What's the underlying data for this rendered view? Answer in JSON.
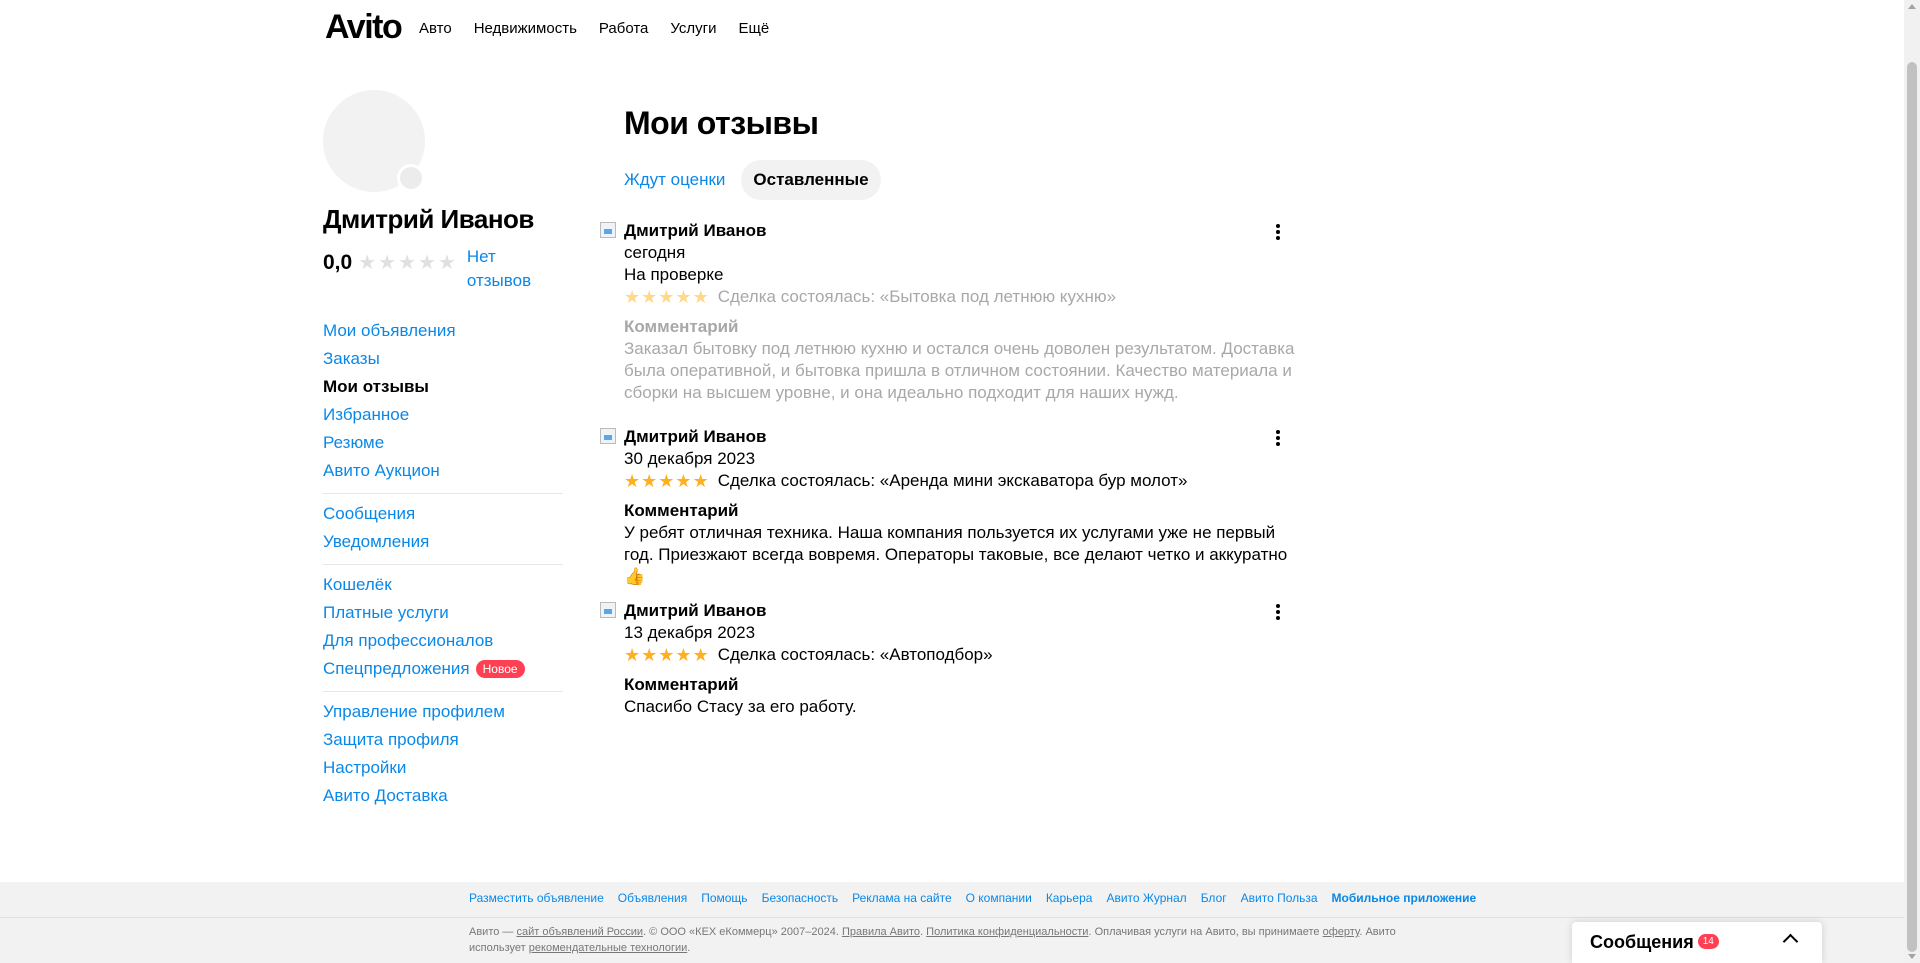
{
  "header": {
    "logo": "Avito",
    "nav": [
      "Авто",
      "Недвижимость",
      "Работа",
      "Услуги",
      "Ещё"
    ]
  },
  "profile": {
    "name": "Дмитрий Иванов",
    "rating": "0,0",
    "no_reviews": "Нет отзывов"
  },
  "menu": {
    "groups": [
      [
        "Мои объявления",
        "Заказы",
        "Мои отзывы",
        "Избранное",
        "Резюме",
        "Авито Аукцион"
      ],
      [
        "Сообщения",
        "Уведомления"
      ],
      [
        "Кошелёк",
        "Платные услуги",
        "Для профессионалов",
        "Спецпредложения"
      ],
      [
        "Управление профилем",
        "Защита профиля",
        "Настройки",
        "Авито Доставка"
      ]
    ],
    "new_badge": "Новое",
    "active": "Мои отзывы"
  },
  "main": {
    "title": "Мои отзывы",
    "tabs": [
      "Ждут оценки",
      "Оставленные"
    ],
    "comment_label": "Комментарий",
    "reviews": [
      {
        "author": "Дмитрий Иванов",
        "date": "сегодня",
        "status": "На проверке",
        "rating": 5,
        "deal": "Сделка состоялась: «Бытовка под летнюю кухню»",
        "comment": "Заказал бытовку под летнюю кухню и остался очень доволен результатом. Доставка была оперативной, и бытовка пришла в отличном состоянии. Качество материала и сборки на высшем уровне, и она идеально подходит для наших нужд."
      },
      {
        "author": "Дмитрий Иванов",
        "date": "30 декабря 2023",
        "rating": 5,
        "deal": "Сделка состоялась: «Аренда мини экскаватора бур молот»",
        "comment": "У ребят отличная техника. Наша компания пользуется их услугами уже не первый год. Приезжают всегда вовремя. Операторы таковые, все делают четко и аккуратно 👍"
      },
      {
        "author": "Дмитрий Иванов",
        "date": "13 декабря 2023",
        "rating": 5,
        "deal": "Сделка состоялась: «Автоподбор»",
        "comment": "Спасибо Стасу за его работу."
      }
    ]
  },
  "footer": {
    "links": [
      "Разместить объявление",
      "Объявления",
      "Помощь",
      "Безопасность",
      "Реклама на сайте",
      "О компании",
      "Карьера",
      "Авито Журнал",
      "Блог",
      "Авито Польза",
      "Мобильное приложение"
    ],
    "legal": {
      "p1": "Авито — ",
      "l1": "сайт объявлений России",
      "p2": ". © ООО «КЕХ еКоммерц» 2007–2024. ",
      "l2": "Правила Авито",
      "p3": ". ",
      "l3": "Политика конфиденциальности",
      "p4": ". Оплачивая услуги на Авито, вы принимаете ",
      "l4": "оферту",
      "p5": ". Авито использует ",
      "l5": "рекомендательные технологии",
      "p6": "."
    }
  },
  "messages_widget": {
    "label": "Сообщения",
    "count": "14"
  },
  "colors": {
    "link": "#0a88e8",
    "star": "#ffb021",
    "badge": "#ff4053"
  }
}
